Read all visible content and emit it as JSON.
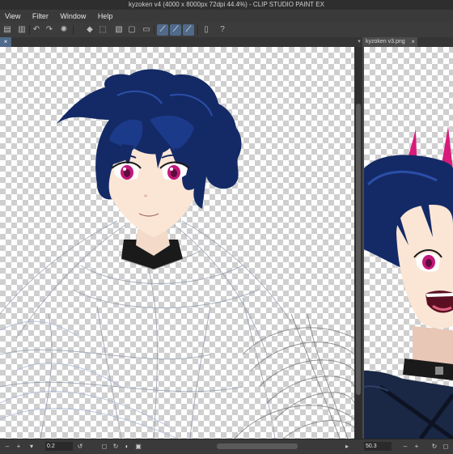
{
  "window": {
    "title": "kyzoken v4 (4000 x 8000px 72dpi 44.4%) - CLIP STUDIO PAINT EX"
  },
  "menu": {
    "items": [
      "View",
      "Filter",
      "Window",
      "Help"
    ]
  },
  "tabs": {
    "left_close": "×",
    "right_label": "kyzoken v3.png",
    "right_close": "×"
  },
  "status": {
    "left_zoom": "0.2",
    "right_zoom": "50.3"
  },
  "colors": {
    "hair": "#142a66",
    "eyes": "#c2187a",
    "skin": "#fbe6d6",
    "horn": "#d81b7a",
    "accent": "#4f6a8a"
  },
  "icons": {
    "undo": "undo-icon",
    "redo": "redo-icon",
    "rotate": "loading-icon",
    "fill": "fill-icon",
    "help": "help-icon"
  }
}
